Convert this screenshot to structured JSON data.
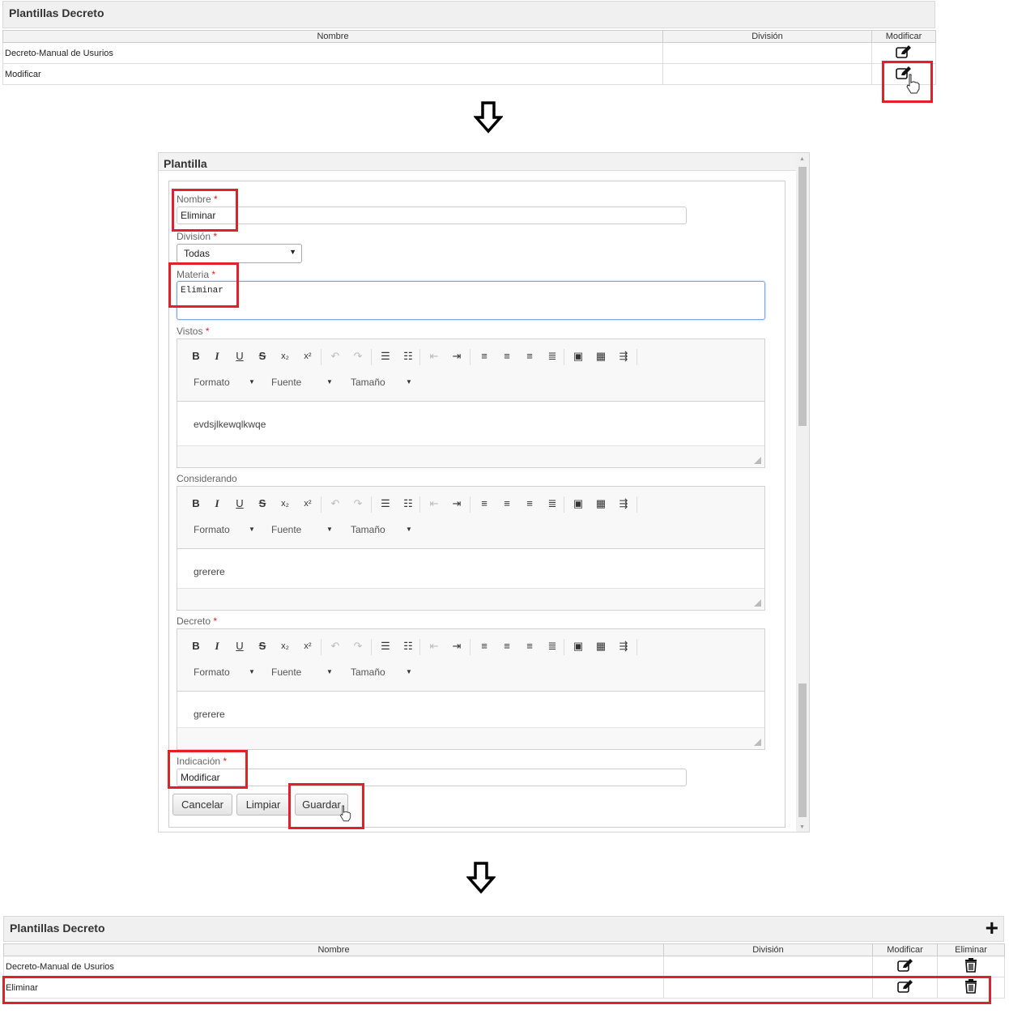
{
  "top_panel": {
    "title": "Plantillas Decreto",
    "columns": [
      "Nombre",
      "División",
      "Modificar"
    ],
    "rows": [
      {
        "nombre": "Decreto-Manual de Usurios",
        "division": ""
      },
      {
        "nombre": "Modificar",
        "division": ""
      }
    ]
  },
  "dialog": {
    "title": "Plantilla",
    "nombre_label": "Nombre",
    "nombre_value": "Eliminar",
    "division_label": "División",
    "division_value": "Todas",
    "materia_label": "Materia",
    "materia_value": "Eliminar",
    "required_mark": "*",
    "editors": [
      {
        "label": "Vistos",
        "required": true,
        "content": "evdsjlkewqlkwqe"
      },
      {
        "label": "Considerando",
        "required": false,
        "content": "grerere"
      },
      {
        "label": "Decreto",
        "required": true,
        "content": "grerere"
      }
    ],
    "toolbar": {
      "bold": "B",
      "italic": "I",
      "underline": "U",
      "strike": "S",
      "subscript": "x₂",
      "superscript": "x²",
      "format_label": "Formato",
      "font_label": "Fuente",
      "size_label": "Tamaño"
    },
    "indicacion_label": "Indicación",
    "indicacion_value": "Modificar",
    "buttons": {
      "cancel": "Cancelar",
      "clear": "Limpiar",
      "save": "Guardar"
    }
  },
  "bottom_panel": {
    "title": "Plantillas Decreto",
    "add_symbol": "+",
    "columns": [
      "Nombre",
      "División",
      "Modificar",
      "Eliminar"
    ],
    "rows": [
      {
        "nombre": "Decreto-Manual de Usurios",
        "division": ""
      },
      {
        "nombre": "Eliminar",
        "division": ""
      }
    ]
  },
  "colors": {
    "highlight": "#e0202a",
    "required": "#e02020",
    "panel_header": "#f0f0f0"
  },
  "icons": [
    "edit-icon",
    "trash-icon",
    "hand-cursor-icon",
    "down-arrow-icon",
    "plus-icon"
  ]
}
